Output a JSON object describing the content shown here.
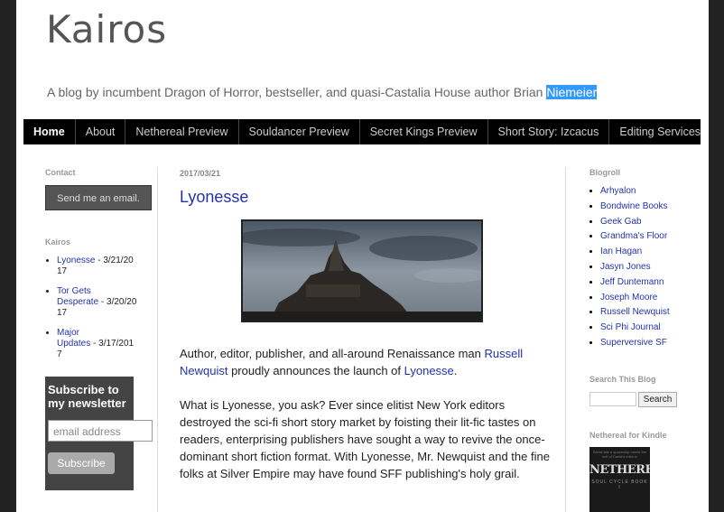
{
  "blog": {
    "title": "Kairos",
    "tagline_prefix": "A blog by incumbent Dragon of Horror, bestseller, and quasi-Castalia House author Brian ",
    "tagline_selected": "Niemeier"
  },
  "nav": {
    "tabs": [
      {
        "label": "Home",
        "active": true
      },
      {
        "label": "About"
      },
      {
        "label": "Nethereal Preview"
      },
      {
        "label": "Souldancer Preview"
      },
      {
        "label": "Secret Kings Preview"
      },
      {
        "label": "Short Story: Izcacus"
      },
      {
        "label": "Editing Services"
      }
    ]
  },
  "left": {
    "contact_heading": "Contact",
    "contact_button": "Send me an email.",
    "archive_heading": "Kairos",
    "archive": [
      {
        "title": "Lyonesse",
        "date": " - 3/21/20",
        "date2": "17"
      },
      {
        "title": "Tor Gets",
        "title2": "Desperate",
        "date": " - 3/20/20",
        "date2": "17"
      },
      {
        "title": "Major",
        "title2": "Updates",
        "date": " - 3/17/201",
        "date2": "7"
      }
    ],
    "subscribe_title": "Subscribe to my newsletter",
    "email_placeholder": "email address",
    "subscribe_button": "Subscribe"
  },
  "post": {
    "date": "2017/03/21",
    "title": "Lyonesse",
    "p1_text1": "Author, editor, publisher, and all-around Renaissance man ",
    "p1_link1": "Russell Newquist",
    "p1_text2": " proudly announces the launch of ",
    "p1_link2": "Lyonesse",
    "p1_text3": ".",
    "p2": "What is Lyonesse, you ask? Ever since elitist New York editors destroyed the sci-fi short story market by foisting their lit-fic tastes on readers, enterprising publishers have sought a way to revive the once-dominant short fiction format. With Lyonesse, Mr. Newquist and the fine folks at Silver Empire may have found SFF publishing's holy grail."
  },
  "right": {
    "blogroll_heading": "Blogroll",
    "blogroll": [
      "Arhyalon",
      "Bondwine Books",
      "Geek Gab",
      "Grandma's Floor",
      "Ian Hagan",
      "Jasyn Jones",
      "Jeff Duntemann",
      "Joseph Moore",
      "Russell Newquist",
      "Sci Phi Journal",
      "Superversive SF"
    ],
    "search_heading": "Search This Blog",
    "search_button": "Search",
    "kindle_heading": "Nethereal for Kindle",
    "kindle_tagline": "Weird tale a spaceship meets the hell of Dante's Inferno",
    "kindle_title": "NETHEREAL",
    "kindle_subtitle": "SOUL CYCLE BOOK I"
  }
}
